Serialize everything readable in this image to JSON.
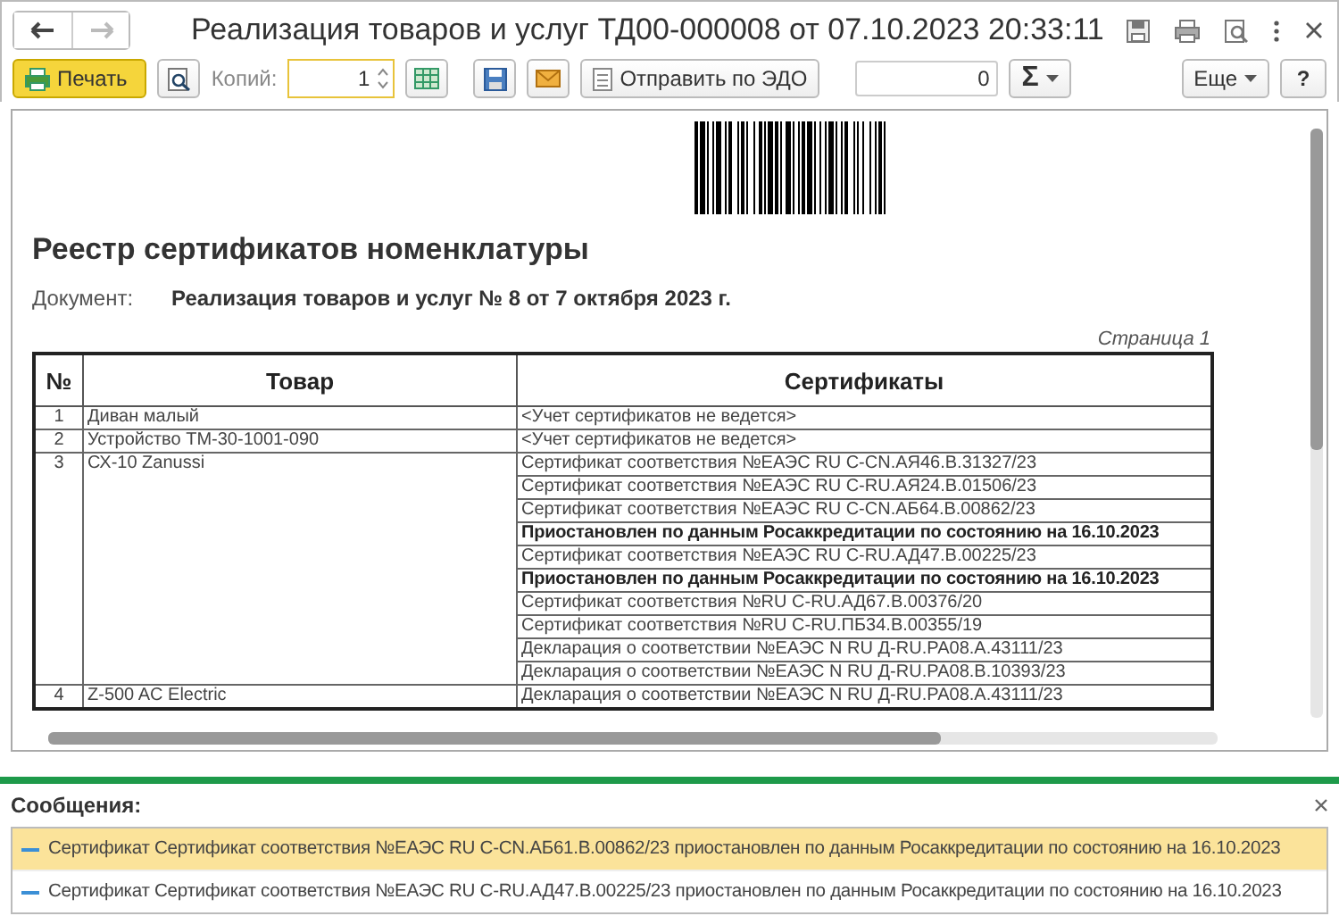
{
  "window": {
    "title": "Реализация товаров и услуг ТД00-000008 от 07.10.2023 20:33:11"
  },
  "toolbar": {
    "print_button": "Печать",
    "copies_label": "Копий:",
    "copies_value": "1",
    "send_button": "Отправить по ЭДО",
    "sum_value": "0",
    "sum_button": "Σ",
    "more_button": "Еще",
    "help_button": "?"
  },
  "document": {
    "title": "Реестр сертификатов номенклатуры",
    "doc_label": "Документ:",
    "doc_value": "Реализация товаров и услуг № 8 от 7 октября 2023 г.",
    "page_label": "Страница 1",
    "table": {
      "columns": [
        "№",
        "Товар",
        "Сертификаты"
      ],
      "rows": [
        {
          "num": "1",
          "product": "Диван малый",
          "certificates": [
            {
              "text": "<Учет сертификатов не ведется>",
              "kind": "normal"
            }
          ]
        },
        {
          "num": "2",
          "product": "Устройство ТМ-30-1001-090",
          "certificates": [
            {
              "text": "<Учет сертификатов не ведется>",
              "kind": "normal"
            }
          ]
        },
        {
          "num": "3",
          "product": "СХ-10 Zanussi",
          "certificates": [
            {
              "text": "Сертификат соответствия №ЕАЭС RU C-CN.АЯ46.В.31327/23",
              "kind": "normal"
            },
            {
              "text": "Сертификат соответствия №ЕАЭС RU C-RU.АЯ24.В.01506/23",
              "kind": "normal"
            },
            {
              "text": "Сертификат соответствия №ЕАЭС RU C-CN.АБ64.В.00862/23",
              "kind": "normal"
            },
            {
              "text": "Приостановлен по данным Росаккредитации по состоянию на 16.10.2023",
              "kind": "suspended"
            },
            {
              "text": "Сертификат соответствия №ЕАЭС RU C-RU.АД47.В.00225/23",
              "kind": "normal"
            },
            {
              "text": "Приостановлен по данным Росаккредитации по состоянию на 16.10.2023",
              "kind": "suspended"
            },
            {
              "text": "Сертификат соответствия №RU C-RU.АД67.В.00376/20",
              "kind": "normal"
            },
            {
              "text": "Сертификат соответствия №RU C-RU.ПБ34.В.00355/19",
              "kind": "normal"
            },
            {
              "text": "Декларация о соответствии №ЕАЭС N RU Д-RU.РА08.А.43111/23",
              "kind": "normal"
            },
            {
              "text": "Декларация о соответствии №ЕАЭС N RU Д-RU.РА08.В.10393/23",
              "kind": "normal"
            }
          ]
        },
        {
          "num": "4",
          "product": "Z-500 AC Electric",
          "certificates": [
            {
              "text": "Декларация о соответствии №ЕАЭС N RU Д-RU.РА08.А.43111/23",
              "kind": "normal"
            }
          ]
        }
      ]
    }
  },
  "messages": {
    "title": "Сообщения:",
    "items": [
      {
        "text": "Сертификат Сертификат соответствия №ЕАЭС RU C-CN.АБ61.В.00862/23 приостановлен по данным Росаккредитации по состоянию на 16.10.2023",
        "selected": true
      },
      {
        "text": "Сертификат Сертификат соответствия №ЕАЭС RU C-RU.АД47.В.00225/23 приостановлен по данным Росаккредитации по состоянию на 16.10.2023",
        "selected": false
      }
    ]
  }
}
